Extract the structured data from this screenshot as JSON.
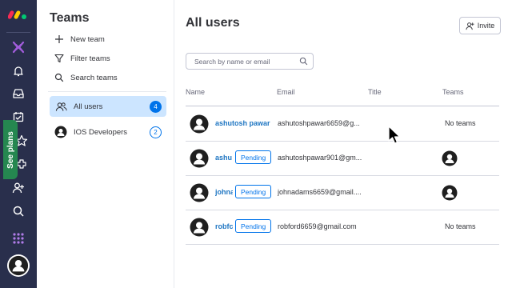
{
  "rail": {
    "logo": "monday-logo",
    "see_plans": "See plans",
    "icons": [
      "workspace-icon",
      "bell-icon",
      "inbox-icon",
      "my-work-icon",
      "favorites-icon",
      "apps-icon",
      "invite-members-icon",
      "search-icon",
      "apps-grid-icon",
      "user-avatar-icon"
    ]
  },
  "teams_panel": {
    "title": "Teams",
    "actions": [
      {
        "label": "New team",
        "icon": "plus-icon"
      },
      {
        "label": "Filter teams",
        "icon": "filter-icon"
      },
      {
        "label": "Search teams",
        "icon": "search-icon"
      }
    ],
    "items": [
      {
        "label": "All users",
        "count": "4",
        "active": true,
        "icon": "users-icon"
      },
      {
        "label": "IOS Developers",
        "count": "2",
        "active": false,
        "icon": "team-avatar-icon"
      }
    ]
  },
  "main": {
    "title": "All users",
    "invite_label": "Invite",
    "search_placeholder": "Search by name or email",
    "columns": [
      "Name",
      "Email",
      "Title",
      "Teams"
    ],
    "rows": [
      {
        "name": "ashutosh pawar",
        "pending": "",
        "email": "ashutoshpawar6659@g...",
        "teams": "No teams"
      },
      {
        "name": "ashu",
        "pending": "Pending",
        "email": "ashutoshpawar901@gm...",
        "teams": ""
      },
      {
        "name": "johna",
        "pending": "Pending",
        "email": "johnadams6659@gmail....",
        "teams": ""
      },
      {
        "name": "robfc",
        "pending": "Pending",
        "email": "robford6659@gmail.com",
        "teams": "No teams"
      }
    ]
  },
  "colors": {
    "rail_bg": "#292f4c",
    "accent": "#0073ea",
    "see_plans_bg": "#258750",
    "active_item_bg": "#cce5ff"
  }
}
